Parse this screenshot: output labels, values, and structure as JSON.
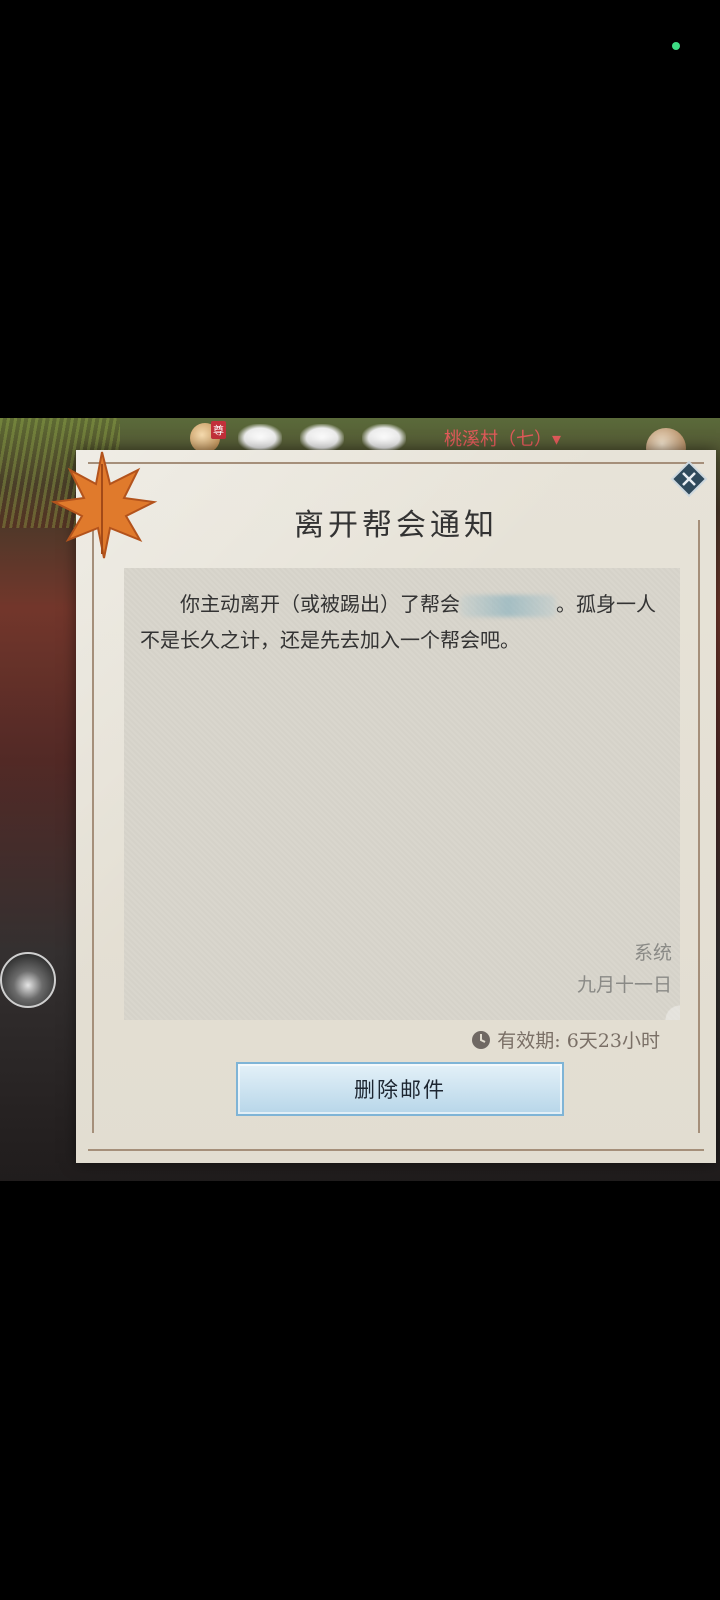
{
  "hud": {
    "badge_tag": "尊",
    "location": "桃溪村（七）▾"
  },
  "mail": {
    "title": "离开帮会通知",
    "body_before": "你主动离开（或被踢出）了帮会",
    "body_after": "。孤身一人不是长久之计，还是先去加入一个帮会吧。",
    "sender": "系统",
    "date": "九月十一日",
    "expiry": "有效期: 6天23小时",
    "delete_label": "删除邮件"
  },
  "colors": {
    "panel_bg": "#e2ddd1",
    "content_bg": "#d8d5cc",
    "button_border": "#7fb4d6",
    "location_text": "#e25a5a"
  },
  "icons": {
    "close": "close-icon",
    "clock": "clock-icon",
    "leaf": "maple-leaf-icon"
  }
}
